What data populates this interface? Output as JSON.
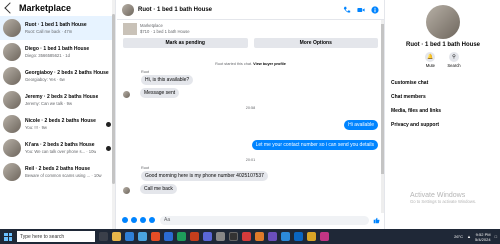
{
  "left": {
    "title": "Marketplace",
    "conversations": [
      {
        "name": "Ruot · 1 bed 1 bath House",
        "sub": "Ruot: Call me back · 47m",
        "active": true
      },
      {
        "name": "Diego · 1 bed 1 bath House",
        "sub": "Diego: 3566585621 · 1d"
      },
      {
        "name": "Georgiaboy · 2 beds 2 baths House",
        "sub": "Georgiaboy: Yes · 6w"
      },
      {
        "name": "Jeremy · 2 beds 2 baths House",
        "sub": "Jeremy: Can we talk · 9w"
      },
      {
        "name": "Nicole · 2 beds 2 baths House",
        "sub": "You: !!! · 9w"
      },
      {
        "name": "Ki'ara · 2 beds 2 baths House",
        "sub": "You: We can talk over phone s... · 10w"
      },
      {
        "name": "Reil · 2 beds 2 baths House",
        "sub": "Beware of common scams using ... · 10w"
      }
    ]
  },
  "chat": {
    "title": "Ruot · 1 bed 1 bath House",
    "listing_line1": "Marketplace",
    "listing_line2": "$710 · 1 bed 1 bath House",
    "mark_pending": "Mark as pending",
    "more_options": "More Options",
    "started": "Ruot started this chat.",
    "view_profile": "View buyer profile",
    "sender1": "Ruot",
    "msg1": "Hi, is this available?",
    "msg2": "Message sent",
    "time1": "20:58",
    "out1": "Hi available",
    "out2": "Let me your contact number so i can send you details",
    "time2": "20:01",
    "sender2": "Ruot",
    "msg3": "Good morning here is my phone number 4025107537",
    "msg4": "Call me back",
    "input_placeholder": "Aa"
  },
  "right": {
    "title": "Ruot · 1 bed 1 bath House",
    "mute": "Mute",
    "search": "Search",
    "items": [
      "Customise chat",
      "Chat members",
      "Media, files and links",
      "Privacy and support"
    ]
  },
  "watermark": {
    "line1": "Activate Windows",
    "line2": "Go to Settings to activate Windows."
  },
  "taskbar": {
    "search_placeholder": "Type here to search",
    "temp": "26°C",
    "time": "9:52 PM",
    "date": "5/4/2024"
  }
}
